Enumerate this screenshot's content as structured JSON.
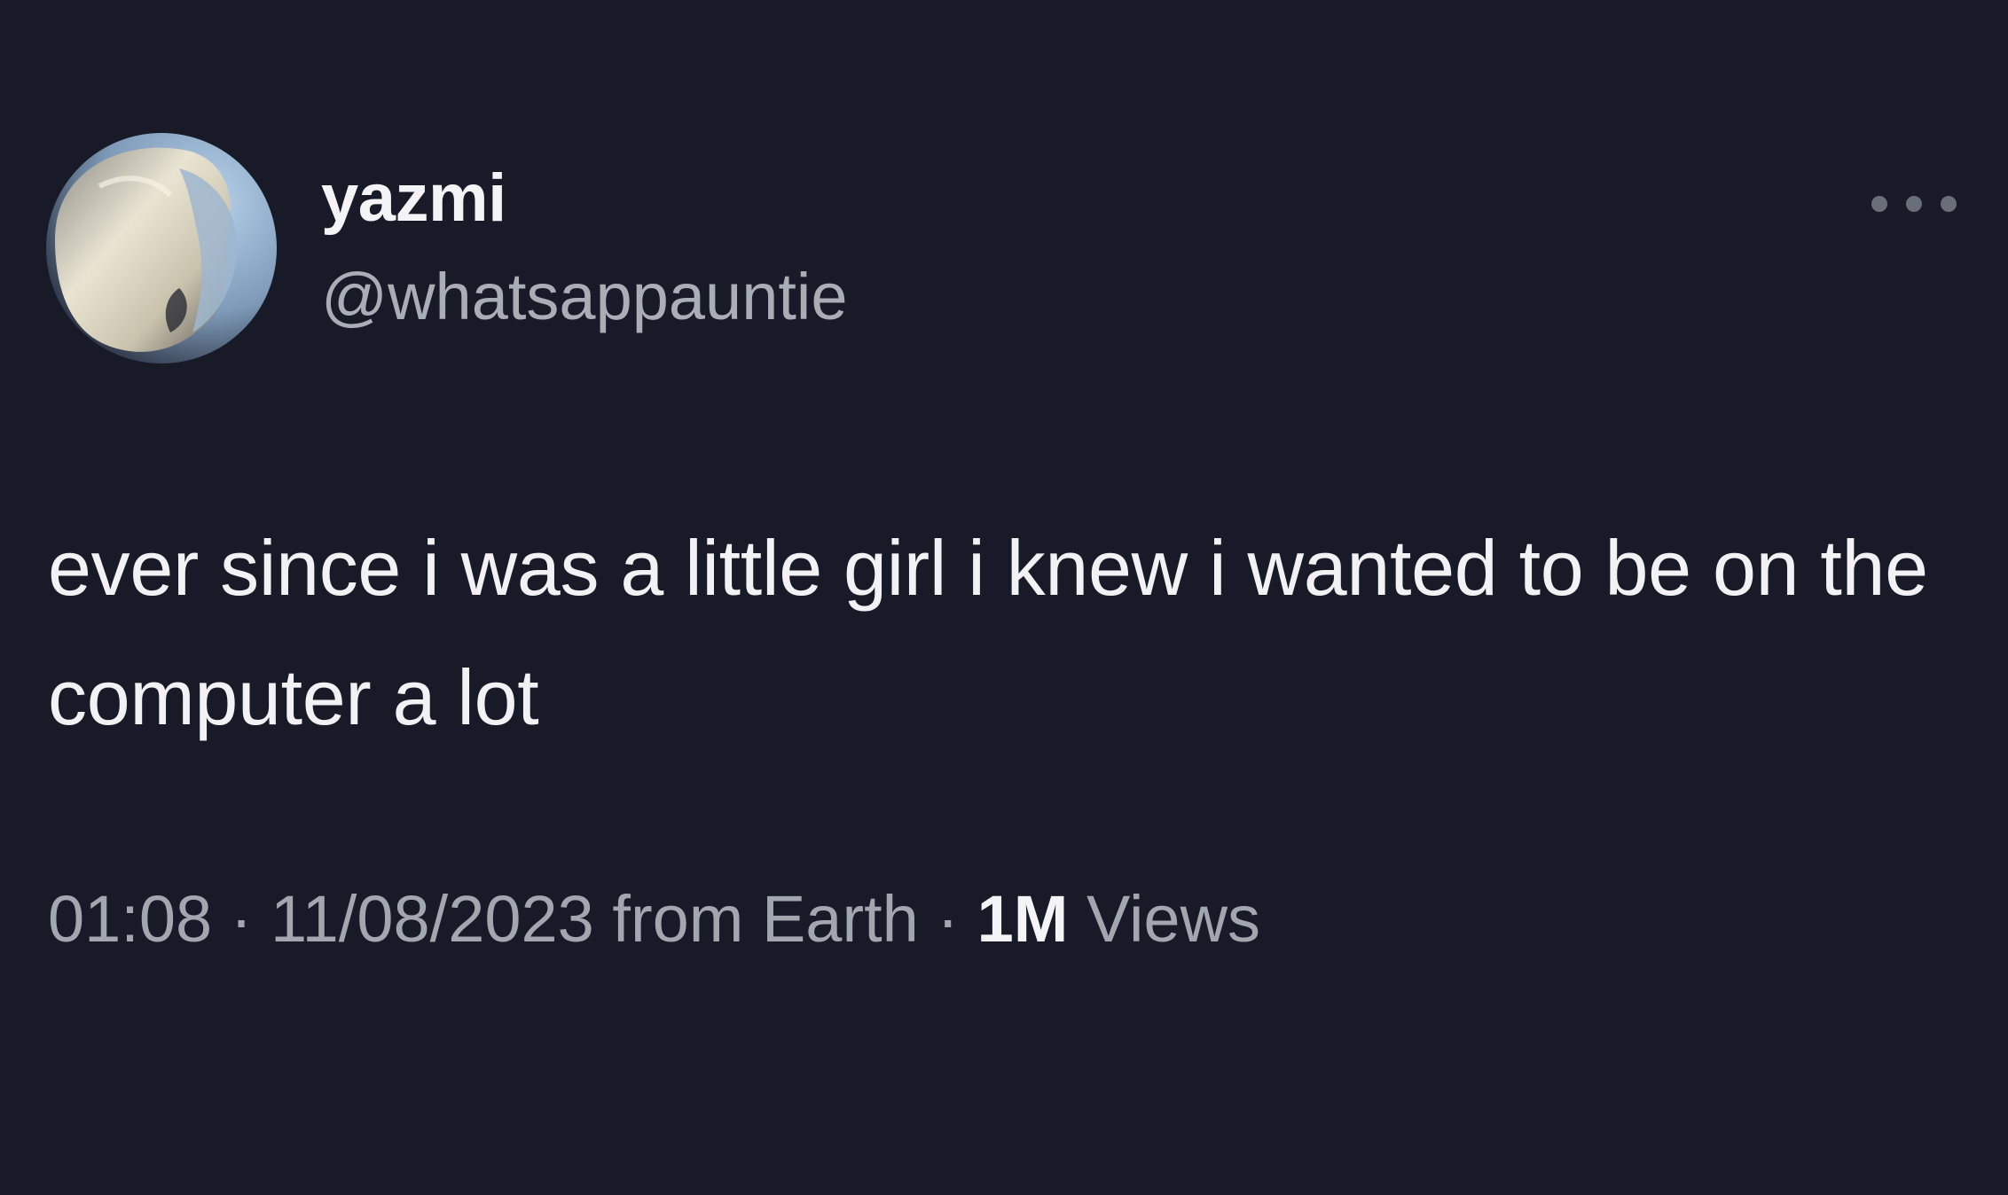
{
  "tweet": {
    "display_name": "yazmi",
    "handle": "@whatsappauntie",
    "more_icon": "more-horizontal-icon",
    "text": "ever since i was a little girl i knew i wanted to be on the computer a lot",
    "meta": {
      "time": "01:08",
      "separator_1": " · ",
      "date": "11/08/2023",
      "source": " from Earth",
      "separator_2": " · ",
      "views_count": "1M",
      "views_label": " Views"
    }
  },
  "colors": {
    "background": "#181b27",
    "primary_text": "#f2f2f4",
    "secondary_text": "#a2a6ae"
  }
}
